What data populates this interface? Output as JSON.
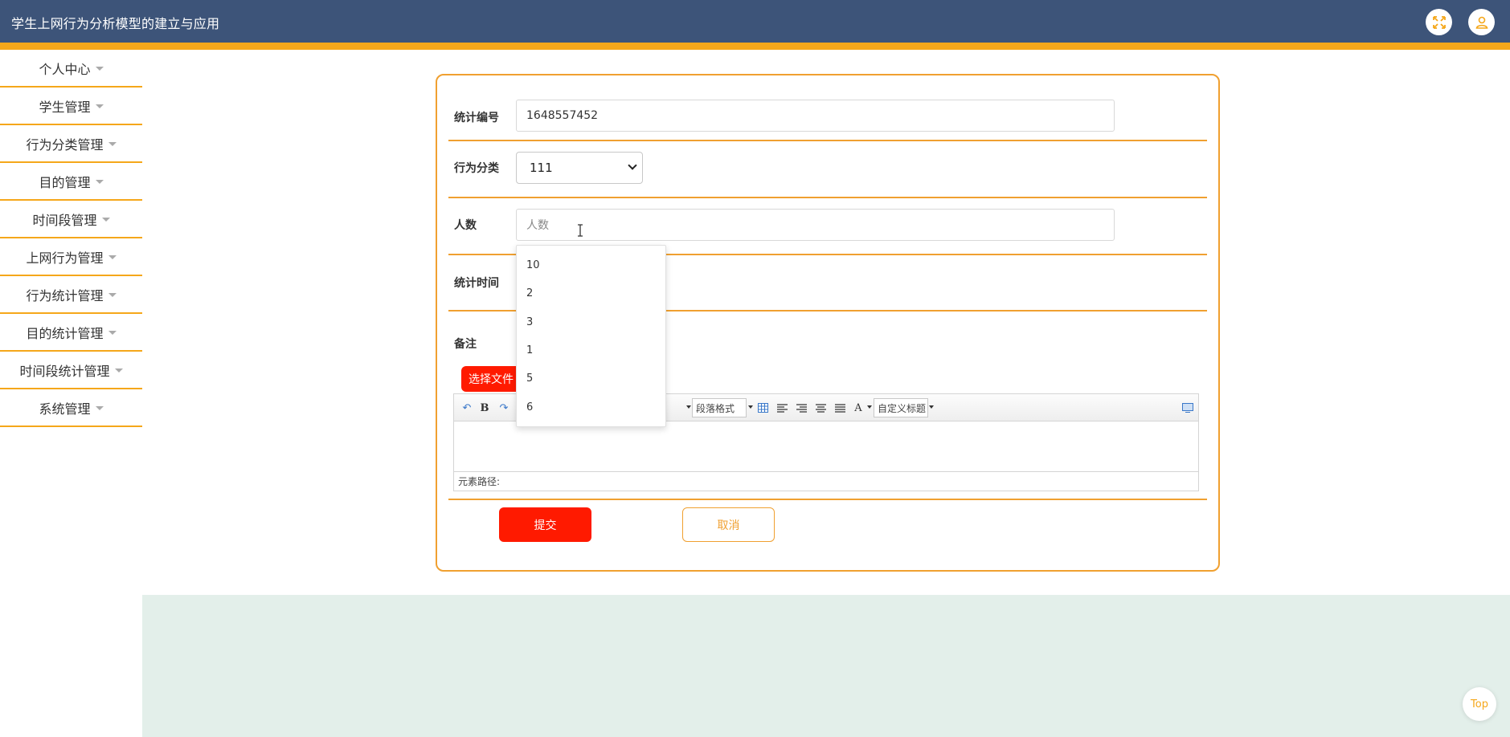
{
  "app": {
    "title": "学生上网行为分析模型的建立与应用"
  },
  "sidebar": {
    "items": [
      {
        "label": "个人中心"
      },
      {
        "label": "学生管理"
      },
      {
        "label": "行为分类管理"
      },
      {
        "label": "目的管理"
      },
      {
        "label": "时间段管理"
      },
      {
        "label": "上网行为管理"
      },
      {
        "label": "行为统计管理"
      },
      {
        "label": "目的统计管理"
      },
      {
        "label": "时间段统计管理"
      },
      {
        "label": "系统管理"
      }
    ]
  },
  "form": {
    "stat_no": {
      "label": "统计编号",
      "value": "1648557452"
    },
    "category": {
      "label": "行为分类",
      "value": "111"
    },
    "count": {
      "label": "人数",
      "placeholder": "人数"
    },
    "stat_time": {
      "label": "统计时间"
    },
    "remark": {
      "label": "备注"
    },
    "file_button": "选择文件",
    "editor": {
      "paragraph_format": "段落格式",
      "custom_heading": "自定义标题",
      "element_path": "元素路径:"
    },
    "submit_label": "提交",
    "cancel_label": "取消"
  },
  "dropdown": {
    "options": [
      "10",
      "2",
      "3",
      "1",
      "5",
      "6"
    ]
  },
  "top_button": "Top",
  "colors": {
    "header": "#3d5479",
    "accent": "#f5a71a",
    "danger": "#ff1a00",
    "footer": "#e3efea"
  }
}
